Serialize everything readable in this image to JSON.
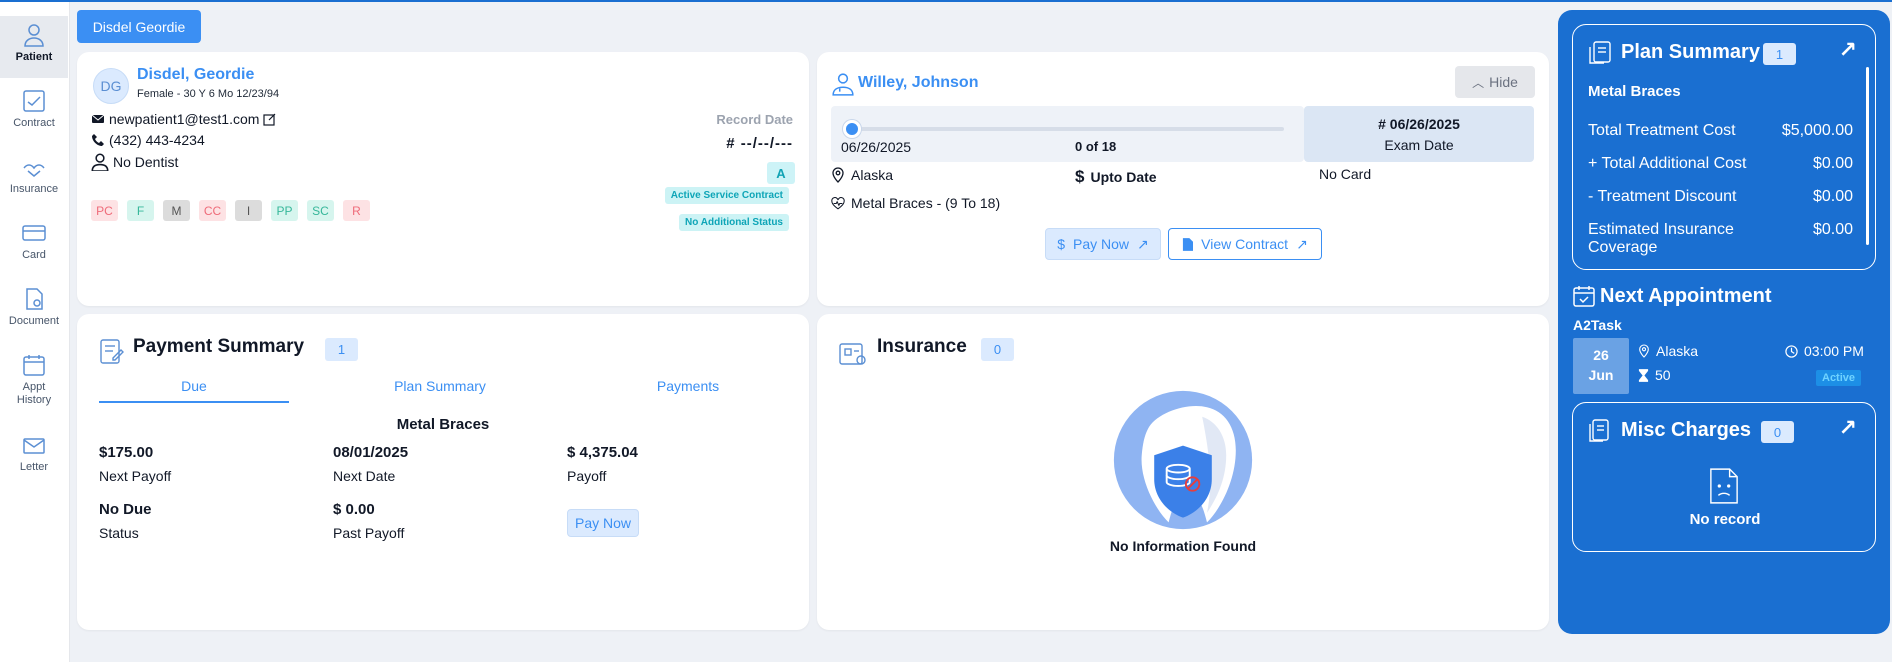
{
  "nav": {
    "items": [
      {
        "label": "Patient"
      },
      {
        "label": "Contract"
      },
      {
        "label": "Insurance"
      },
      {
        "label": "Card"
      },
      {
        "label": "Document"
      },
      {
        "label": "Appt History"
      },
      {
        "label": "Letter"
      }
    ]
  },
  "patient_tab": {
    "label": "Disdel Geordie"
  },
  "patient": {
    "initials": "DG",
    "name": "Disdel, Geordie",
    "details": "Female - 30 Y 6 Mo 12/23/94",
    "email": "newpatient1@test1.com",
    "phone": "(432) 443-4234",
    "dentist": "No Dentist",
    "chips": [
      "PC",
      "F",
      "M",
      "CC",
      "I",
      "PP",
      "SC",
      "R"
    ],
    "record_date_label": "Record Date",
    "record_date_value": "# --/--/---",
    "record_badge": "A",
    "service_status": "Active Service Contract",
    "additional_status": "No Additional Status"
  },
  "provider": {
    "name": "Willey, Johnson",
    "hide_label": "Hide",
    "progress": {
      "date": "06/26/2025",
      "count_label": "0 of 18",
      "completed": 0,
      "total": 18
    },
    "exam_number": "# 06/26/2025",
    "exam_label": "Exam Date",
    "location": "Alaska",
    "payment_status": "Upto Date",
    "card": "No Card",
    "treatment": "Metal Braces - (9 To 18)",
    "pay_now_label": "Pay Now",
    "view_contract_label": "View Contract"
  },
  "payment_summary": {
    "title": "Payment Summary",
    "count": "1",
    "tabs": [
      "Due",
      "Plan Summary",
      "Payments"
    ],
    "plan_name": "Metal Braces",
    "next_payoff_value": "$175.00",
    "next_payoff_label": "Next Payoff",
    "next_date_value": "08/01/2025",
    "next_date_label": "Next Date",
    "payoff_value": "$ 4,375.04",
    "payoff_label": "Payoff",
    "status_value": "No Due",
    "status_label": "Status",
    "past_payoff_value": "$ 0.00",
    "past_payoff_label": "Past Payoff",
    "pay_now_label": "Pay Now"
  },
  "insurance": {
    "title": "Insurance",
    "count": "0",
    "empty_text": "No Information Found"
  },
  "plan_summary": {
    "title": "Plan Summary",
    "count": "1",
    "plan_name": "Metal Braces",
    "rows": [
      {
        "label": "Total Treatment Cost",
        "value": "$5,000.00"
      },
      {
        "label": "+ Total Additional Cost",
        "value": "$0.00"
      },
      {
        "label": "- Treatment Discount",
        "value": "$0.00"
      },
      {
        "label": "Estimated Insurance Coverage",
        "value": "$0.00"
      }
    ]
  },
  "next_appointment": {
    "title": "Next Appointment",
    "task": "A2Task",
    "day": "26",
    "month": "Jun",
    "location": "Alaska",
    "time": "03:00 PM",
    "duration": "50",
    "status": "Active"
  },
  "misc_charges": {
    "title": "Misc Charges",
    "count": "0",
    "empty_text": "No record"
  },
  "colors": {
    "accent": "#3b8ff3",
    "panel": "#1a6fd1",
    "badge_bg": "#dbeafe",
    "teal": "#0ea5b7"
  }
}
